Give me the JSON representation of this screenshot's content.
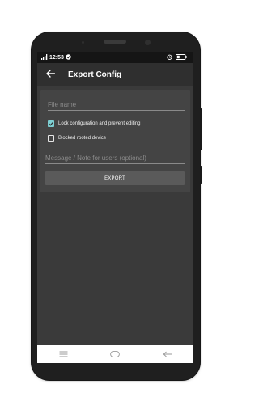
{
  "statusbar": {
    "signal_label": "4G",
    "time": "12:53",
    "battery_label": "22"
  },
  "appbar": {
    "title": "Export Config"
  },
  "form": {
    "file_name_placeholder": "File name",
    "lock_label": "Lock configuration and prevent editing",
    "lock_checked": true,
    "blocked_rooted_label": "Blocked rooted device",
    "blocked_rooted_checked": false,
    "message_placeholder": "Message / Note for users (optional)",
    "export_label": "EXPORT"
  },
  "colors": {
    "accent": "#7ecfd3",
    "background": "#3a3a3a",
    "card": "#444444",
    "appbar": "#2f2f2f"
  },
  "icons": [
    "back-arrow-icon",
    "menu-icon",
    "home-icon",
    "back-icon",
    "alarm-icon",
    "battery-icon",
    "signal-icon"
  ]
}
